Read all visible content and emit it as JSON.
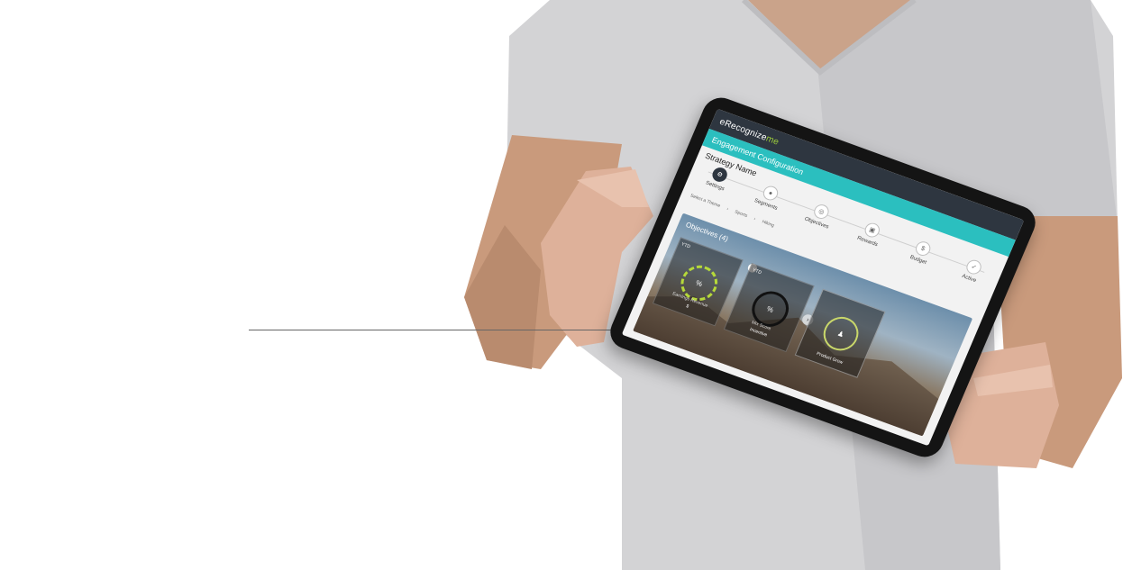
{
  "app": {
    "logo_prefix": "eRecognize",
    "logo_suffix": "me",
    "title": "Engagement Configuration",
    "strategy_name": "Strategy Name"
  },
  "stepper": {
    "steps": [
      {
        "label": "Settings",
        "icon": "gear-icon",
        "active": true
      },
      {
        "label": "Segments",
        "icon": "user-icon",
        "active": false
      },
      {
        "label": "Objectives",
        "icon": "target-icon",
        "active": false
      },
      {
        "label": "Rewards",
        "icon": "gift-icon",
        "active": false
      },
      {
        "label": "Budget",
        "icon": "dollar-icon",
        "active": false
      },
      {
        "label": "Active",
        "icon": "check-icon",
        "active": false
      }
    ]
  },
  "breadcrumb": {
    "items": [
      "Select a Theme",
      "Sports",
      "Hiking"
    ]
  },
  "objectives": {
    "title": "Objectives (4)",
    "cards": [
      {
        "ytd": "YTD",
        "percent_symbol": "%",
        "caption": "Earnings Revenue",
        "sub": "$"
      },
      {
        "ytd": "YTD",
        "percent_symbol": "%",
        "caption": "Mix Score",
        "sub": "Incentive"
      },
      {
        "ytd": "",
        "percent_symbol": "",
        "caption": "Product Grow",
        "sub": ""
      }
    ],
    "next_arrow": "›"
  },
  "colors": {
    "accent": "#2bbfbf",
    "topbar": "#2e3640",
    "logo_highlight": "#9ccc3c",
    "ring_dashed": "#b6d93a"
  }
}
